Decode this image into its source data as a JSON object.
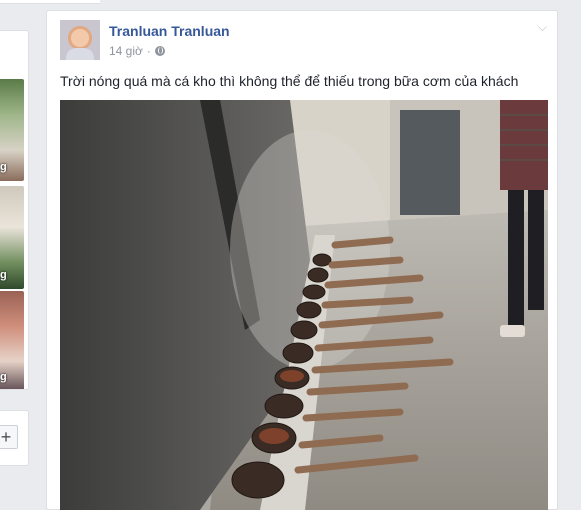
{
  "post": {
    "author": "Tranluan Tranluan",
    "time": "14 giờ",
    "separator": "·",
    "text": "Trời nóng quá mà cá kho thì không thể để thiếu trong bữa cơm của khách",
    "menu_icon": "chevron-down-icon",
    "privacy_icon": "globe-icon"
  },
  "sidebar": {
    "thumb_captions": [
      "g",
      "g",
      "g"
    ],
    "add_button": "+"
  }
}
